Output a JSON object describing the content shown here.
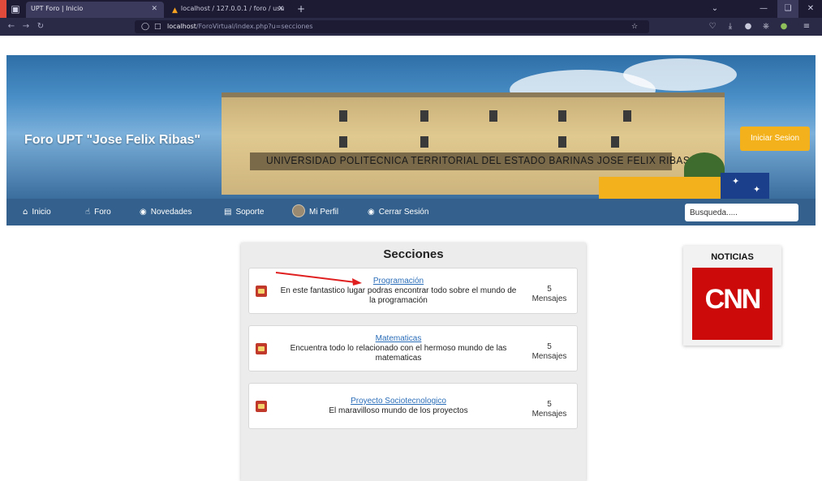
{
  "browser": {
    "tabs": [
      {
        "title": "UPT Foro | Inicio",
        "active": true
      },
      {
        "title": "localhost / 127.0.0.1 / foro / usu",
        "active": false
      }
    ],
    "url_host": "localhost",
    "url_path": "/ForoVirtual/index.php?u=secciones"
  },
  "header": {
    "site_title": "Foro UPT \"Jose Felix Ribas\"",
    "banner_text": "UNIVERSIDAD POLITECNICA TERRITORIAL DEL ESTADO BARINAS JOSE FELIX RIBAS",
    "login_label": "Iniciar Sesion"
  },
  "menu": {
    "items": [
      {
        "label": "Inicio",
        "icon": "home-icon"
      },
      {
        "label": "Foro",
        "icon": "hand-pointer-icon"
      },
      {
        "label": "Novedades",
        "icon": "globe-icon"
      },
      {
        "label": "Soporte",
        "icon": "support-icon"
      },
      {
        "label": "Mi Perfil",
        "icon": "avatar"
      },
      {
        "label": "Cerrar Sesión",
        "icon": "globe-icon"
      }
    ],
    "search_placeholder": "Busqueda....."
  },
  "secciones": {
    "title": "Secciones",
    "items": [
      {
        "name": "Programación",
        "description": "En este fantastico lugar podras encontrar todo sobre el mundo de la programación",
        "count": "5",
        "count_label": "Mensajes"
      },
      {
        "name": "Matematicas",
        "description": "Encuentra todo lo relacionado con el hermoso mundo de las matematicas",
        "count": "5",
        "count_label": "Mensajes"
      },
      {
        "name": "Proyecto Sociotecnologico",
        "description": "El maravilloso mundo de los proyectos",
        "count": "5",
        "count_label": "Mensajes"
      }
    ]
  },
  "noticias": {
    "title": "NOTICIAS",
    "logo_text": "CNN"
  },
  "colors": {
    "menu_bar": "#33608c",
    "accent_yellow": "#f3b21b",
    "cnn_red": "#cc0a0a",
    "link": "#2a6db8"
  }
}
